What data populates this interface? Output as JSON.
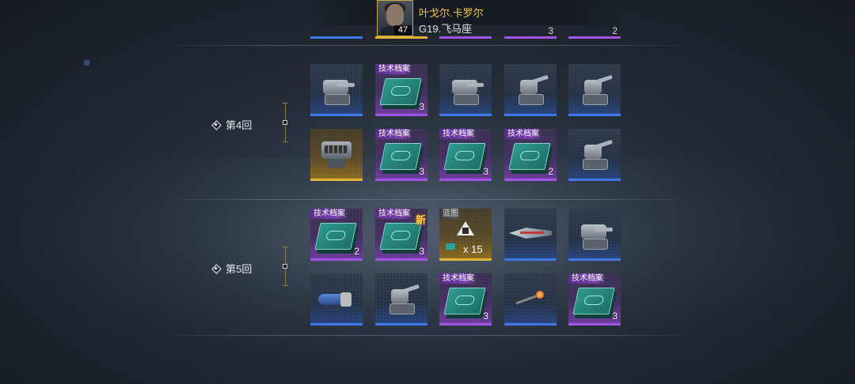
{
  "header": {
    "player_name": "叶戈尔.卡罗尔",
    "player_zone": "G19.飞马座",
    "level": "47",
    "stub_counts": [
      "",
      "",
      "",
      "3",
      "2"
    ]
  },
  "rounds": [
    {
      "label": "第4回",
      "rows": [
        [
          {
            "rarity": "blue",
            "icon": "turret-icon",
            "tag": "",
            "qty": ""
          },
          {
            "rarity": "purple",
            "icon": "tech-document-icon",
            "tag": "技术档案",
            "qty": "3"
          },
          {
            "rarity": "blue",
            "icon": "turret-icon",
            "tag": "",
            "qty": ""
          },
          {
            "rarity": "blue",
            "icon": "gun-turret-icon",
            "tag": "",
            "qty": ""
          },
          {
            "rarity": "blue",
            "icon": "gun-turret-icon",
            "tag": "",
            "qty": ""
          }
        ],
        [
          {
            "rarity": "gold",
            "icon": "weapon-pod-icon",
            "tag": "",
            "qty": ""
          },
          {
            "rarity": "purple",
            "icon": "tech-document-icon",
            "tag": "技术档案",
            "qty": "3"
          },
          {
            "rarity": "purple",
            "icon": "tech-document-icon",
            "tag": "技术档案",
            "qty": "3"
          },
          {
            "rarity": "purple",
            "icon": "tech-document-icon",
            "tag": "技术档案",
            "qty": "2"
          },
          {
            "rarity": "blue",
            "icon": "gun-turret-icon",
            "tag": "",
            "qty": ""
          }
        ]
      ]
    },
    {
      "label": "第5回",
      "rows": [
        [
          {
            "rarity": "purple",
            "icon": "tech-document-icon",
            "tag": "技术档案",
            "qty": "2"
          },
          {
            "rarity": "purple",
            "icon": "tech-document-icon",
            "tag": "技术档案",
            "qty": "3",
            "new": "新"
          },
          {
            "rarity": "gold",
            "icon": "blueprint-icon",
            "tag": "蓝图",
            "qty": "",
            "text": "x 15"
          },
          {
            "rarity": "blue",
            "icon": "ship-icon",
            "tag": "",
            "qty": ""
          },
          {
            "rarity": "blue",
            "icon": "turret-icon",
            "tag": "",
            "qty": ""
          }
        ],
        [
          {
            "rarity": "blue",
            "icon": "cannon-icon",
            "tag": "",
            "qty": ""
          },
          {
            "rarity": "blue",
            "icon": "gun-turret-icon",
            "tag": "",
            "qty": ""
          },
          {
            "rarity": "purple",
            "icon": "tech-document-icon",
            "tag": "技术档案",
            "qty": "3"
          },
          {
            "rarity": "blue",
            "icon": "missile-icon",
            "tag": "",
            "qty": ""
          },
          {
            "rarity": "purple",
            "icon": "tech-document-icon",
            "tag": "技术档案",
            "qty": "3"
          }
        ]
      ]
    }
  ],
  "colors": {
    "blue": "#3f78e8",
    "purple": "#a254e6",
    "gold": "#e0b434",
    "name": "#f0c24a"
  }
}
